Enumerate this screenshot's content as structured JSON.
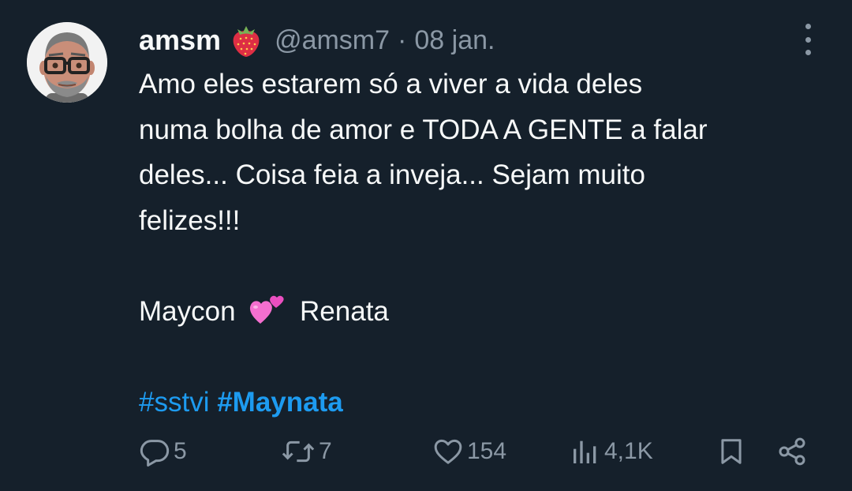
{
  "tweet": {
    "author": {
      "name": "amsm",
      "name_emoji": "strawberry",
      "handle": "@amsm7",
      "separator": "·",
      "date": "08 jan."
    },
    "text_lines": [
      "Amo eles estarem só a viver a vida deles",
      "numa bolha de amor e TODA A GENTE a falar",
      "deles... Coisa feia a inveja... Sejam muito",
      "felizes!!!"
    ],
    "names_line": {
      "left": "Maycon",
      "emoji": "two-hearts",
      "right": "Renata"
    },
    "hashtags": [
      "#sstvi",
      "#Maynata"
    ]
  },
  "actions": {
    "replies": "5",
    "retweets": "7",
    "likes": "154",
    "views": "4,1K"
  },
  "icons": {
    "more": "more-vertical-icon",
    "reply": "reply-bubble-icon",
    "retweet": "retweet-icon",
    "like": "heart-icon",
    "views": "views-bar-chart-icon",
    "bookmark": "bookmark-icon",
    "share": "share-icon"
  },
  "colors": {
    "background": "#15202b",
    "text": "#f7f9f9",
    "secondary": "#8b98a5",
    "link": "#1d9bf0"
  }
}
